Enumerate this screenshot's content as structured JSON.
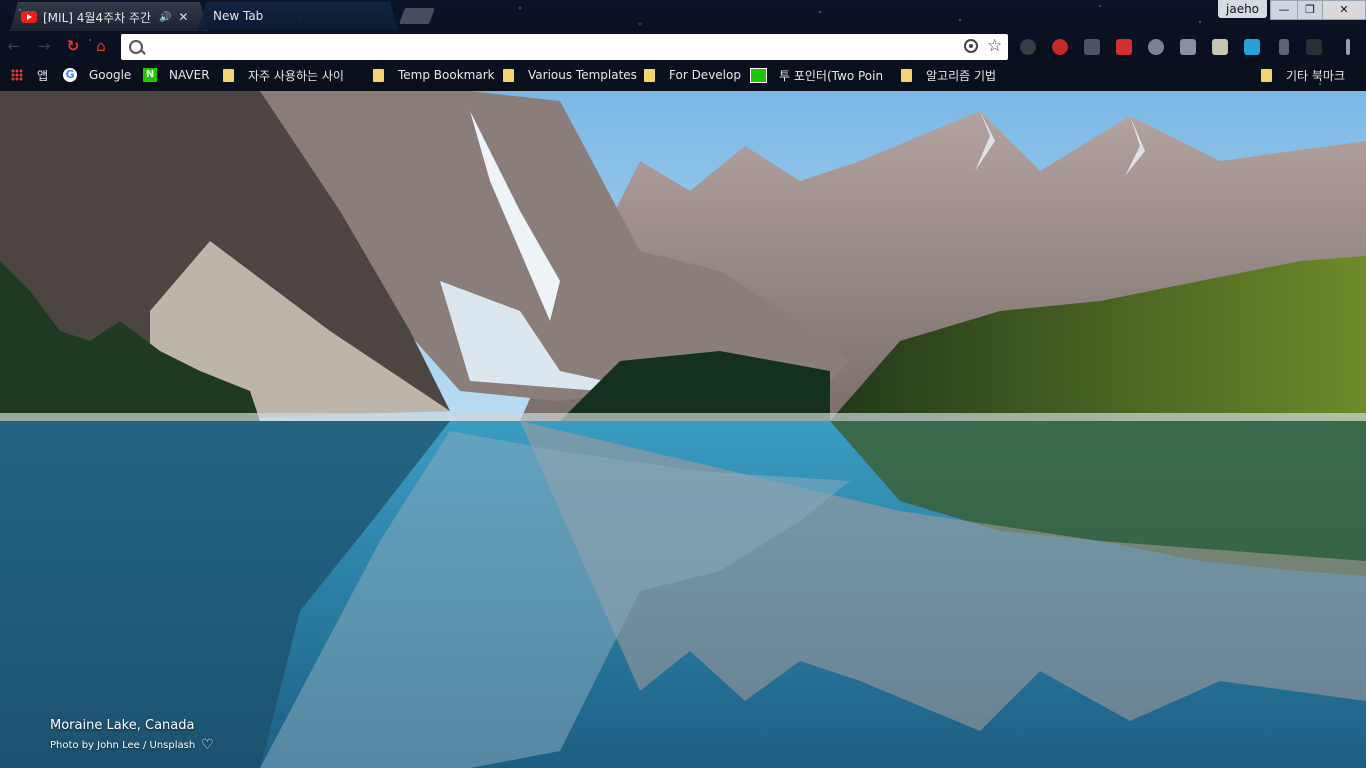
{
  "tabs": [
    {
      "title": "[MIL] 4월4주차 주간",
      "icon": "youtube-icon",
      "audio": "🔊",
      "close": "✕"
    },
    {
      "title": "New Tab"
    }
  ],
  "profile": {
    "name": "jaeho"
  },
  "window_controls": {
    "minimize": "—",
    "maximize": "❐",
    "close": "✕"
  },
  "toolbar": {
    "back": "←",
    "forward": "→",
    "reload": "↻",
    "home": "⌂",
    "omnibox_value": "",
    "star": "☆"
  },
  "bookmarks": [
    {
      "label": "앱",
      "icon": "apps-icon"
    },
    {
      "label": "Google",
      "icon": "google-icon"
    },
    {
      "label": "NAVER",
      "icon": "naver-icon"
    },
    {
      "label": "자주 사용하는 사이",
      "icon": "folder-icon"
    },
    {
      "label": "Temp Bookmark",
      "icon": "folder-icon"
    },
    {
      "label": "Various Templates",
      "icon": "folder-icon"
    },
    {
      "label": "For Develop",
      "icon": "folder-icon"
    },
    {
      "label": "투 포인터(Two Poin",
      "icon": "green-icon"
    },
    {
      "label": "알고리즘 기법",
      "icon": "folder-icon"
    },
    {
      "label": "기타 북마크",
      "icon": "folder-icon"
    }
  ],
  "photo": {
    "location": "Moraine Lake, Canada",
    "credit": "Photo by John Lee / Unsplash",
    "heart": "♡"
  },
  "colors": {
    "sky": "#8fc4ea",
    "water": "#2b7ea3",
    "forest": "#2f4a1e",
    "rock": "#9a8f8a"
  }
}
